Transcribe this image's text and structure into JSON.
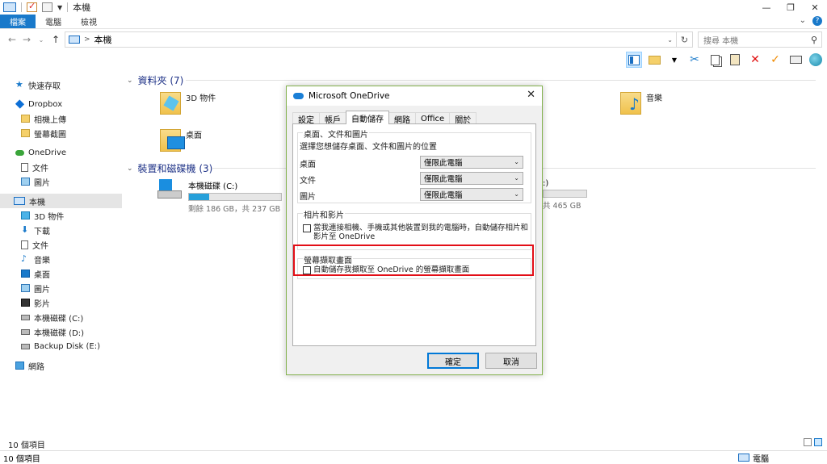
{
  "window": {
    "title": "本機",
    "controls": [
      "—",
      "❐",
      "✕"
    ]
  },
  "ribbon": {
    "tabs": [
      "檔案",
      "電腦",
      "檢視"
    ],
    "help": "?"
  },
  "address": {
    "sep": ">",
    "path": "本機",
    "search_placeholder": "搜尋 本機"
  },
  "sidebar": {
    "items": [
      {
        "label": "快速存取"
      },
      {
        "label": "Dropbox"
      },
      {
        "label": "相機上傳"
      },
      {
        "label": "螢幕截圖"
      },
      {
        "label": "OneDrive"
      },
      {
        "label": "文件"
      },
      {
        "label": "圖片"
      },
      {
        "label": "本機"
      },
      {
        "label": "3D 物件"
      },
      {
        "label": "下載"
      },
      {
        "label": "文件"
      },
      {
        "label": "音樂"
      },
      {
        "label": "桌面"
      },
      {
        "label": "圖片"
      },
      {
        "label": "影片"
      },
      {
        "label": "本機磁碟 (C:)"
      },
      {
        "label": "本機磁碟 (D:)"
      },
      {
        "label": "Backup Disk (E:)"
      },
      {
        "label": "網路"
      }
    ]
  },
  "main": {
    "folders_header": "資料夾 (7)",
    "folders": [
      {
        "label": "3D 物件"
      },
      {
        "label": "桌面"
      },
      {
        "label": "音樂"
      }
    ],
    "drives_header": "裝置和磁碟機 (3)",
    "drives": [
      {
        "label": "本機磁碟 (C:)",
        "free": "剩餘 186 GB，共 237 GB",
        "used_fraction": 0.22
      },
      {
        "label": ":)",
        "free": "共 465 GB",
        "used_fraction": 0.0
      }
    ]
  },
  "status": {
    "items_top": "10 個項目",
    "items_bottom": "10 個項目",
    "location": "電腦"
  },
  "dialog": {
    "title": "Microsoft OneDrive",
    "tabs": [
      "設定",
      "帳戶",
      "自動儲存",
      "網路",
      "Office",
      "關於"
    ],
    "active_tab": "自動儲存",
    "section1": {
      "legend": "桌面、文件和圖片",
      "description": "選擇您想儲存桌面、文件和圖片的位置",
      "rows": [
        {
          "label": "桌面",
          "value": "僅限此電腦"
        },
        {
          "label": "文件",
          "value": "僅限此電腦"
        },
        {
          "label": "圖片",
          "value": "僅限此電腦"
        }
      ]
    },
    "section2": {
      "legend": "相片和影片",
      "checkbox_label": "當我連接相機、手機或其他裝置到我的電腦時，自動儲存相片和影片至 OneDrive",
      "checked": false
    },
    "section3": {
      "legend": "螢幕擷取畫面",
      "checkbox_label": "自動儲存我擷取至 OneDrive 的螢幕擷取畫面",
      "checked": false
    },
    "ok_label": "確定",
    "cancel_label": "取消"
  },
  "colors": {
    "accent": "#1979ca",
    "highlight": "#e30e17",
    "dialog_border": "#83b24d"
  }
}
